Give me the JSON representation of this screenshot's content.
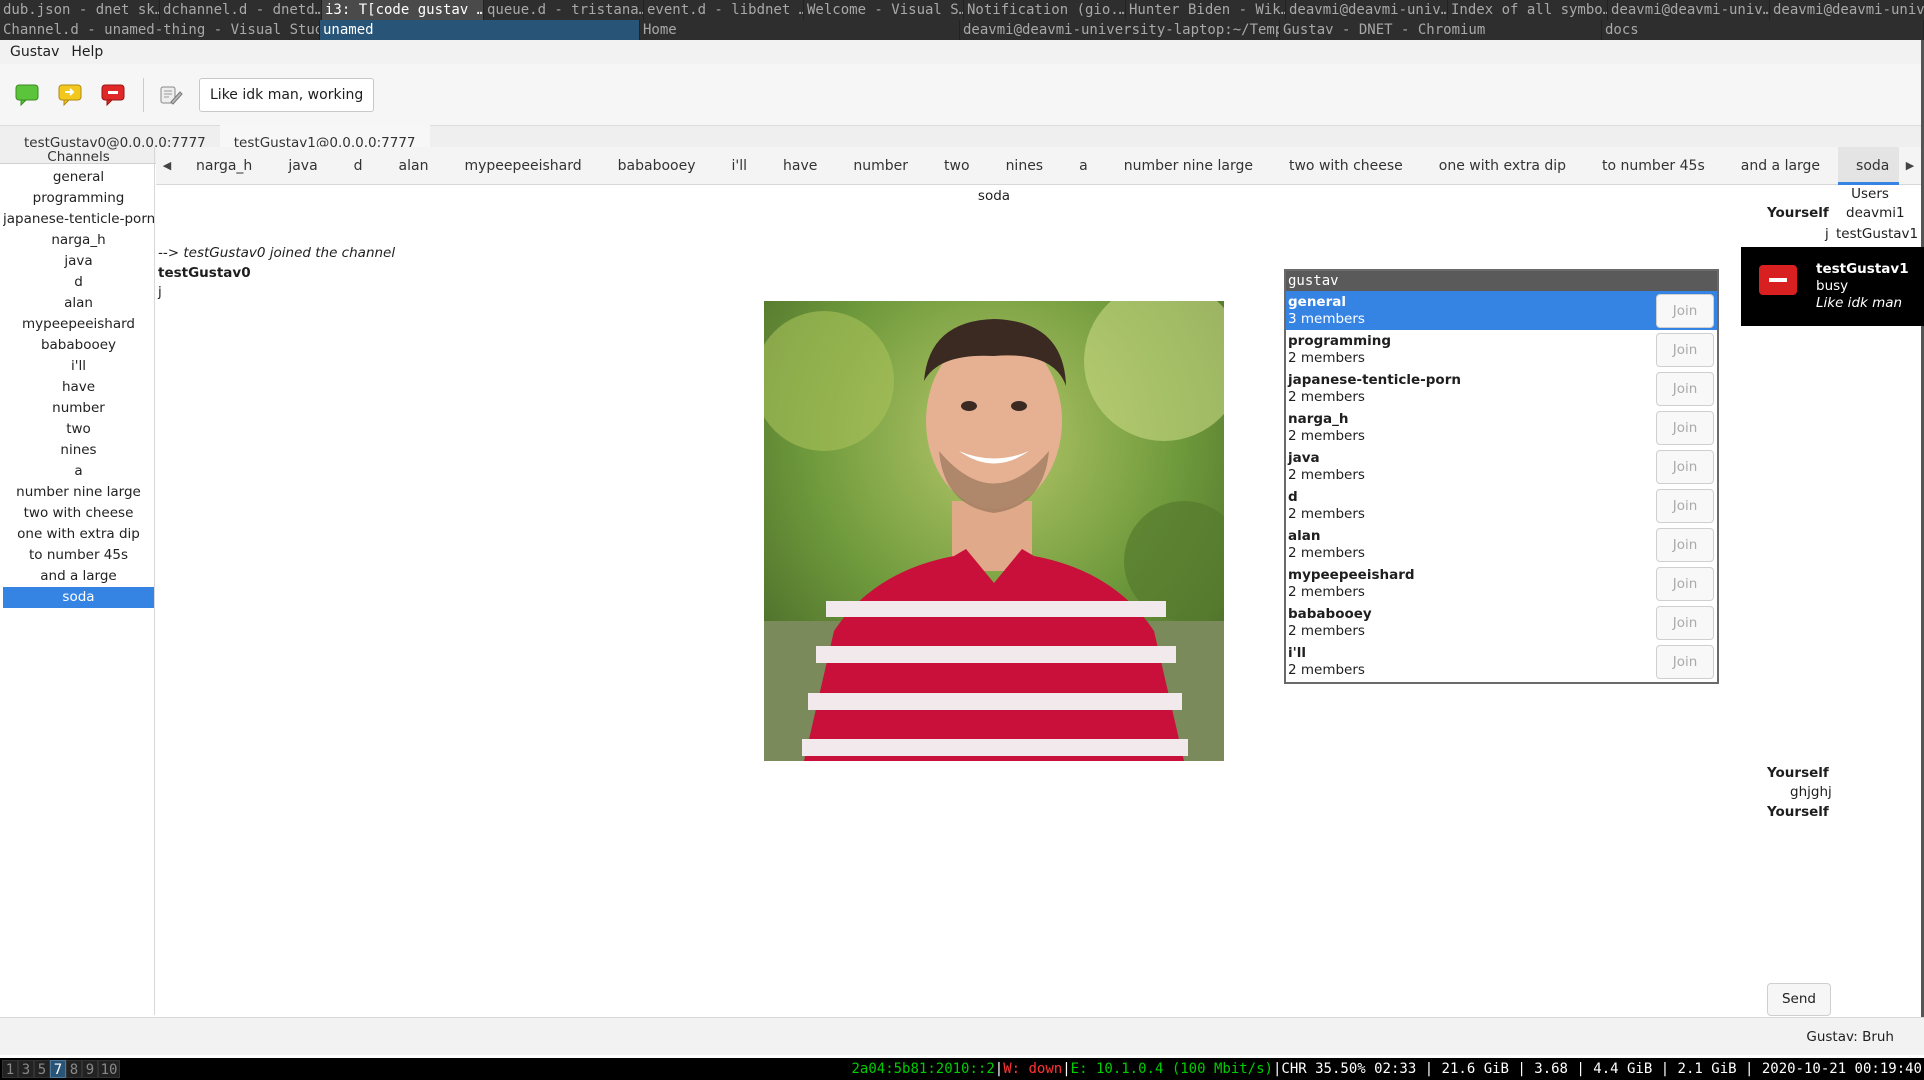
{
  "window_titles_row1": [
    "dub.json - dnet sk…",
    "dchannel.d - dnetd…",
    "i3: T[code gustav …",
    "queue.d - tristana…",
    "event.d - libdnet …",
    "Welcome - Visual S…",
    "Notification (gio.…",
    "Hunter Biden - Wik…",
    "deavmi@deavmi-univ…",
    "Index of all symbo…",
    "deavmi@deavmi-univ…",
    "deavmi@deavmi-univ…"
  ],
  "window_titles_row2": [
    "Channel.d - unamed-thing - Visual Stud…",
    "unamed",
    "Home",
    "deavmi@deavmi-university-laptop:~/Temp…",
    "Gustav - DNET - Chromium",
    "docs"
  ],
  "menu": {
    "gustav": "Gustav",
    "help": "Help"
  },
  "toolbar": {
    "status_text": "Like idk man, working"
  },
  "connection_tabs": [
    "testGustav0@0.0.0.0:7777",
    "testGustav1@0.0.0.0:7777"
  ],
  "sidebar": {
    "heading": "Channels",
    "items": [
      "general",
      "programming",
      "japanese-tenticle-porn",
      "narga_h",
      "java",
      "d",
      "alan",
      "mypeepeeishard",
      "bababooey",
      "i'll",
      "have",
      "number",
      "two",
      "nines",
      "a",
      "number nine large",
      "two with cheese",
      "one with extra dip",
      "to number 45s",
      "and a large",
      "soda"
    ]
  },
  "channel_tabs": [
    "narga_h",
    "java",
    "d",
    "alan",
    "mypeepeeishard",
    "bababooey",
    "i'll",
    "have",
    "number",
    "two",
    "nines",
    "a",
    "number nine large",
    "two with cheese",
    "one with extra dip",
    "to number 45s",
    "and a large",
    "soda"
  ],
  "channel": {
    "title": "soda",
    "join_msg": "--> testGustav0 joined the channel",
    "sender": "testGustav0",
    "body": "j"
  },
  "users": {
    "heading": "Users",
    "yourself1": "Yourself",
    "user1": "deavmi1",
    "j_prefix": "j",
    "user2": "testGustav1",
    "yourself2": "Yourself",
    "msg2": "ghjghj",
    "yourself3": "Yourself"
  },
  "popup": {
    "title": "gustav",
    "join_label": "Join",
    "rows": [
      {
        "name": "general",
        "members": "3 members"
      },
      {
        "name": "programming",
        "members": "2 members"
      },
      {
        "name": "japanese-tenticle-porn",
        "members": "2 members"
      },
      {
        "name": "narga_h",
        "members": "2 members"
      },
      {
        "name": "java",
        "members": "2 members"
      },
      {
        "name": "d",
        "members": "2 members"
      },
      {
        "name": "alan",
        "members": "2 members"
      },
      {
        "name": "mypeepeeishard",
        "members": "2 members"
      },
      {
        "name": "bababooey",
        "members": "2 members"
      },
      {
        "name": "i'll",
        "members": "2 members"
      }
    ]
  },
  "notification": {
    "user": "testGustav1",
    "status": "busy",
    "message": "Like idk man"
  },
  "send_label": "Send",
  "statusbar": {
    "text": "Gustav: Bruh"
  },
  "i3bar": {
    "workspaces": [
      "1",
      "3",
      "5",
      "7",
      "8",
      "9",
      "10"
    ],
    "ipv6": "2a04:5b81:2010::2",
    "wifi": "W: down",
    "eth": "E: 10.1.0.4 (100 Mbit/s)",
    "rest": "CHR 35.50% 02:33 | 21.6 GiB | 3.68 | 4.4 GiB | 2.1 GiB | 2020-10-21 00:19:40"
  }
}
